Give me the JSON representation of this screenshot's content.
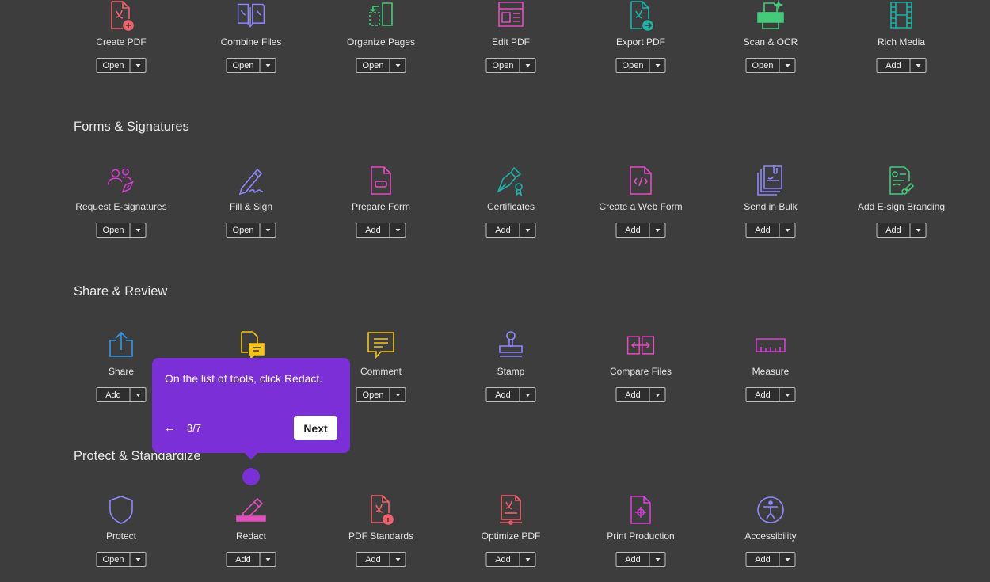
{
  "sections": [
    {
      "title": ""
    },
    {
      "title": "Forms & Signatures"
    },
    {
      "title": "Share & Review"
    },
    {
      "title": "Protect & Standardize"
    }
  ],
  "tools": [
    {
      "label": "Create PDF",
      "button": "Open"
    },
    {
      "label": "Combine Files",
      "button": "Open"
    },
    {
      "label": "Organize Pages",
      "button": "Open"
    },
    {
      "label": "Edit PDF",
      "button": "Open"
    },
    {
      "label": "Export PDF",
      "button": "Open"
    },
    {
      "label": "Scan & OCR",
      "button": "Open"
    },
    {
      "label": "Rich Media",
      "button": "Add"
    },
    {
      "label": "Request E-signatures",
      "button": "Open"
    },
    {
      "label": "Fill & Sign",
      "button": "Open"
    },
    {
      "label": "Prepare Form",
      "button": "Add"
    },
    {
      "label": "Certificates",
      "button": "Add"
    },
    {
      "label": "Create a Web Form",
      "button": "Add"
    },
    {
      "label": "Send in Bulk",
      "button": "Add"
    },
    {
      "label": "Add E-sign Branding",
      "button": "Add"
    },
    {
      "label": "Share",
      "button": "Add"
    },
    {
      "label": "",
      "button": ""
    },
    {
      "label": "Comment",
      "button": "Open"
    },
    {
      "label": "Stamp",
      "button": "Add"
    },
    {
      "label": "Compare Files",
      "button": "Add"
    },
    {
      "label": "Measure",
      "button": "Add"
    },
    {
      "label": "Protect",
      "button": "Open"
    },
    {
      "label": "Redact",
      "button": "Add"
    },
    {
      "label": "PDF Standards",
      "button": "Add"
    },
    {
      "label": "Optimize PDF",
      "button": "Add"
    },
    {
      "label": "Print Production",
      "button": "Add"
    },
    {
      "label": "Accessibility",
      "button": "Add"
    }
  ],
  "coachmark": {
    "message": "On the list of tools, click Redact.",
    "back_icon": "←",
    "step": "3/7",
    "next_label": "Next"
  },
  "colors": {
    "background": "#3d3d3d",
    "coachmark": "#7b2fd6",
    "red": "#f0616d",
    "violet": "#8f86ff",
    "green": "#47c97b",
    "pink": "#e14fbf",
    "teal": "#1ab3a6",
    "blue": "#2d9bf0",
    "yellow": "#f5c518",
    "magenta": "#d63fd6"
  }
}
